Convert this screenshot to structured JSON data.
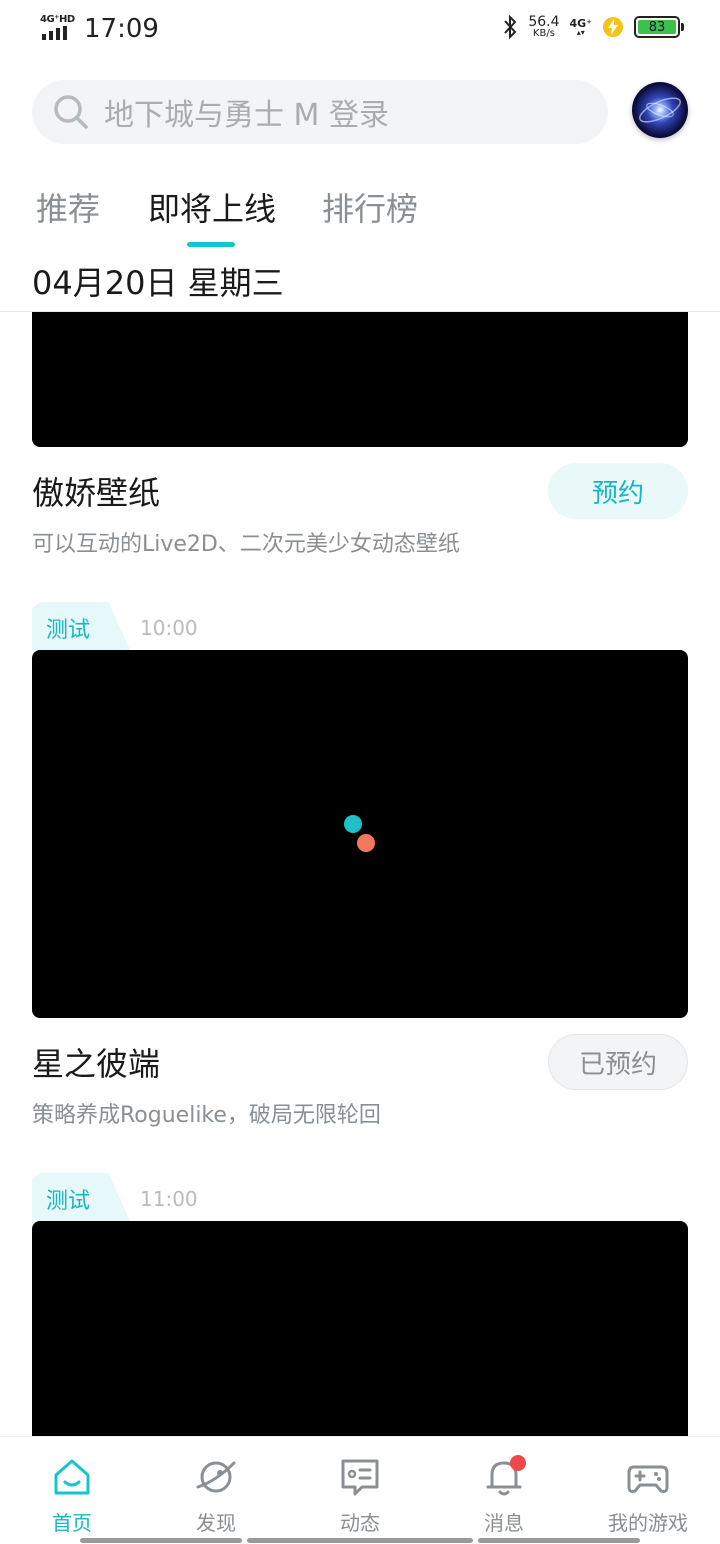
{
  "status_bar": {
    "network_label": "4G⁺HD",
    "time": "17:09",
    "speed_value": "56.4",
    "speed_unit": "KB/s",
    "network_right": "4G⁺",
    "battery": "83"
  },
  "search": {
    "placeholder": "地下城与勇士 M 登录"
  },
  "tabs": [
    {
      "label": "推荐",
      "active": false
    },
    {
      "label": "即将上线",
      "active": true
    },
    {
      "label": "排行榜",
      "active": false
    }
  ],
  "date_header": "04月20日 星期三",
  "games": [
    {
      "title": "傲娇壁纸",
      "description": "可以互动的Live2D、二次元美少女动态壁纸",
      "button": "预约",
      "reserved": false
    },
    {
      "tag": "测试",
      "time": "10:00",
      "title": "星之彼端",
      "description": "策略养成Roguelike，破局无限轮回",
      "button": "已预约",
      "reserved": true
    },
    {
      "tag": "测试",
      "time": "11:00"
    }
  ],
  "bottom_nav": [
    {
      "label": "首页",
      "icon": "home-icon",
      "active": true
    },
    {
      "label": "发现",
      "icon": "planet-icon",
      "active": false
    },
    {
      "label": "动态",
      "icon": "chat-card-icon",
      "active": false
    },
    {
      "label": "消息",
      "icon": "bell-icon",
      "active": false,
      "badge": true
    },
    {
      "label": "我的游戏",
      "icon": "gamepad-icon",
      "active": false
    }
  ],
  "colors": {
    "accent": "#15c5ce",
    "accent_text": "#15b8c2",
    "badge": "#f04848",
    "loader_dot_1": "#1fc0c8",
    "loader_dot_2": "#f5775e"
  }
}
